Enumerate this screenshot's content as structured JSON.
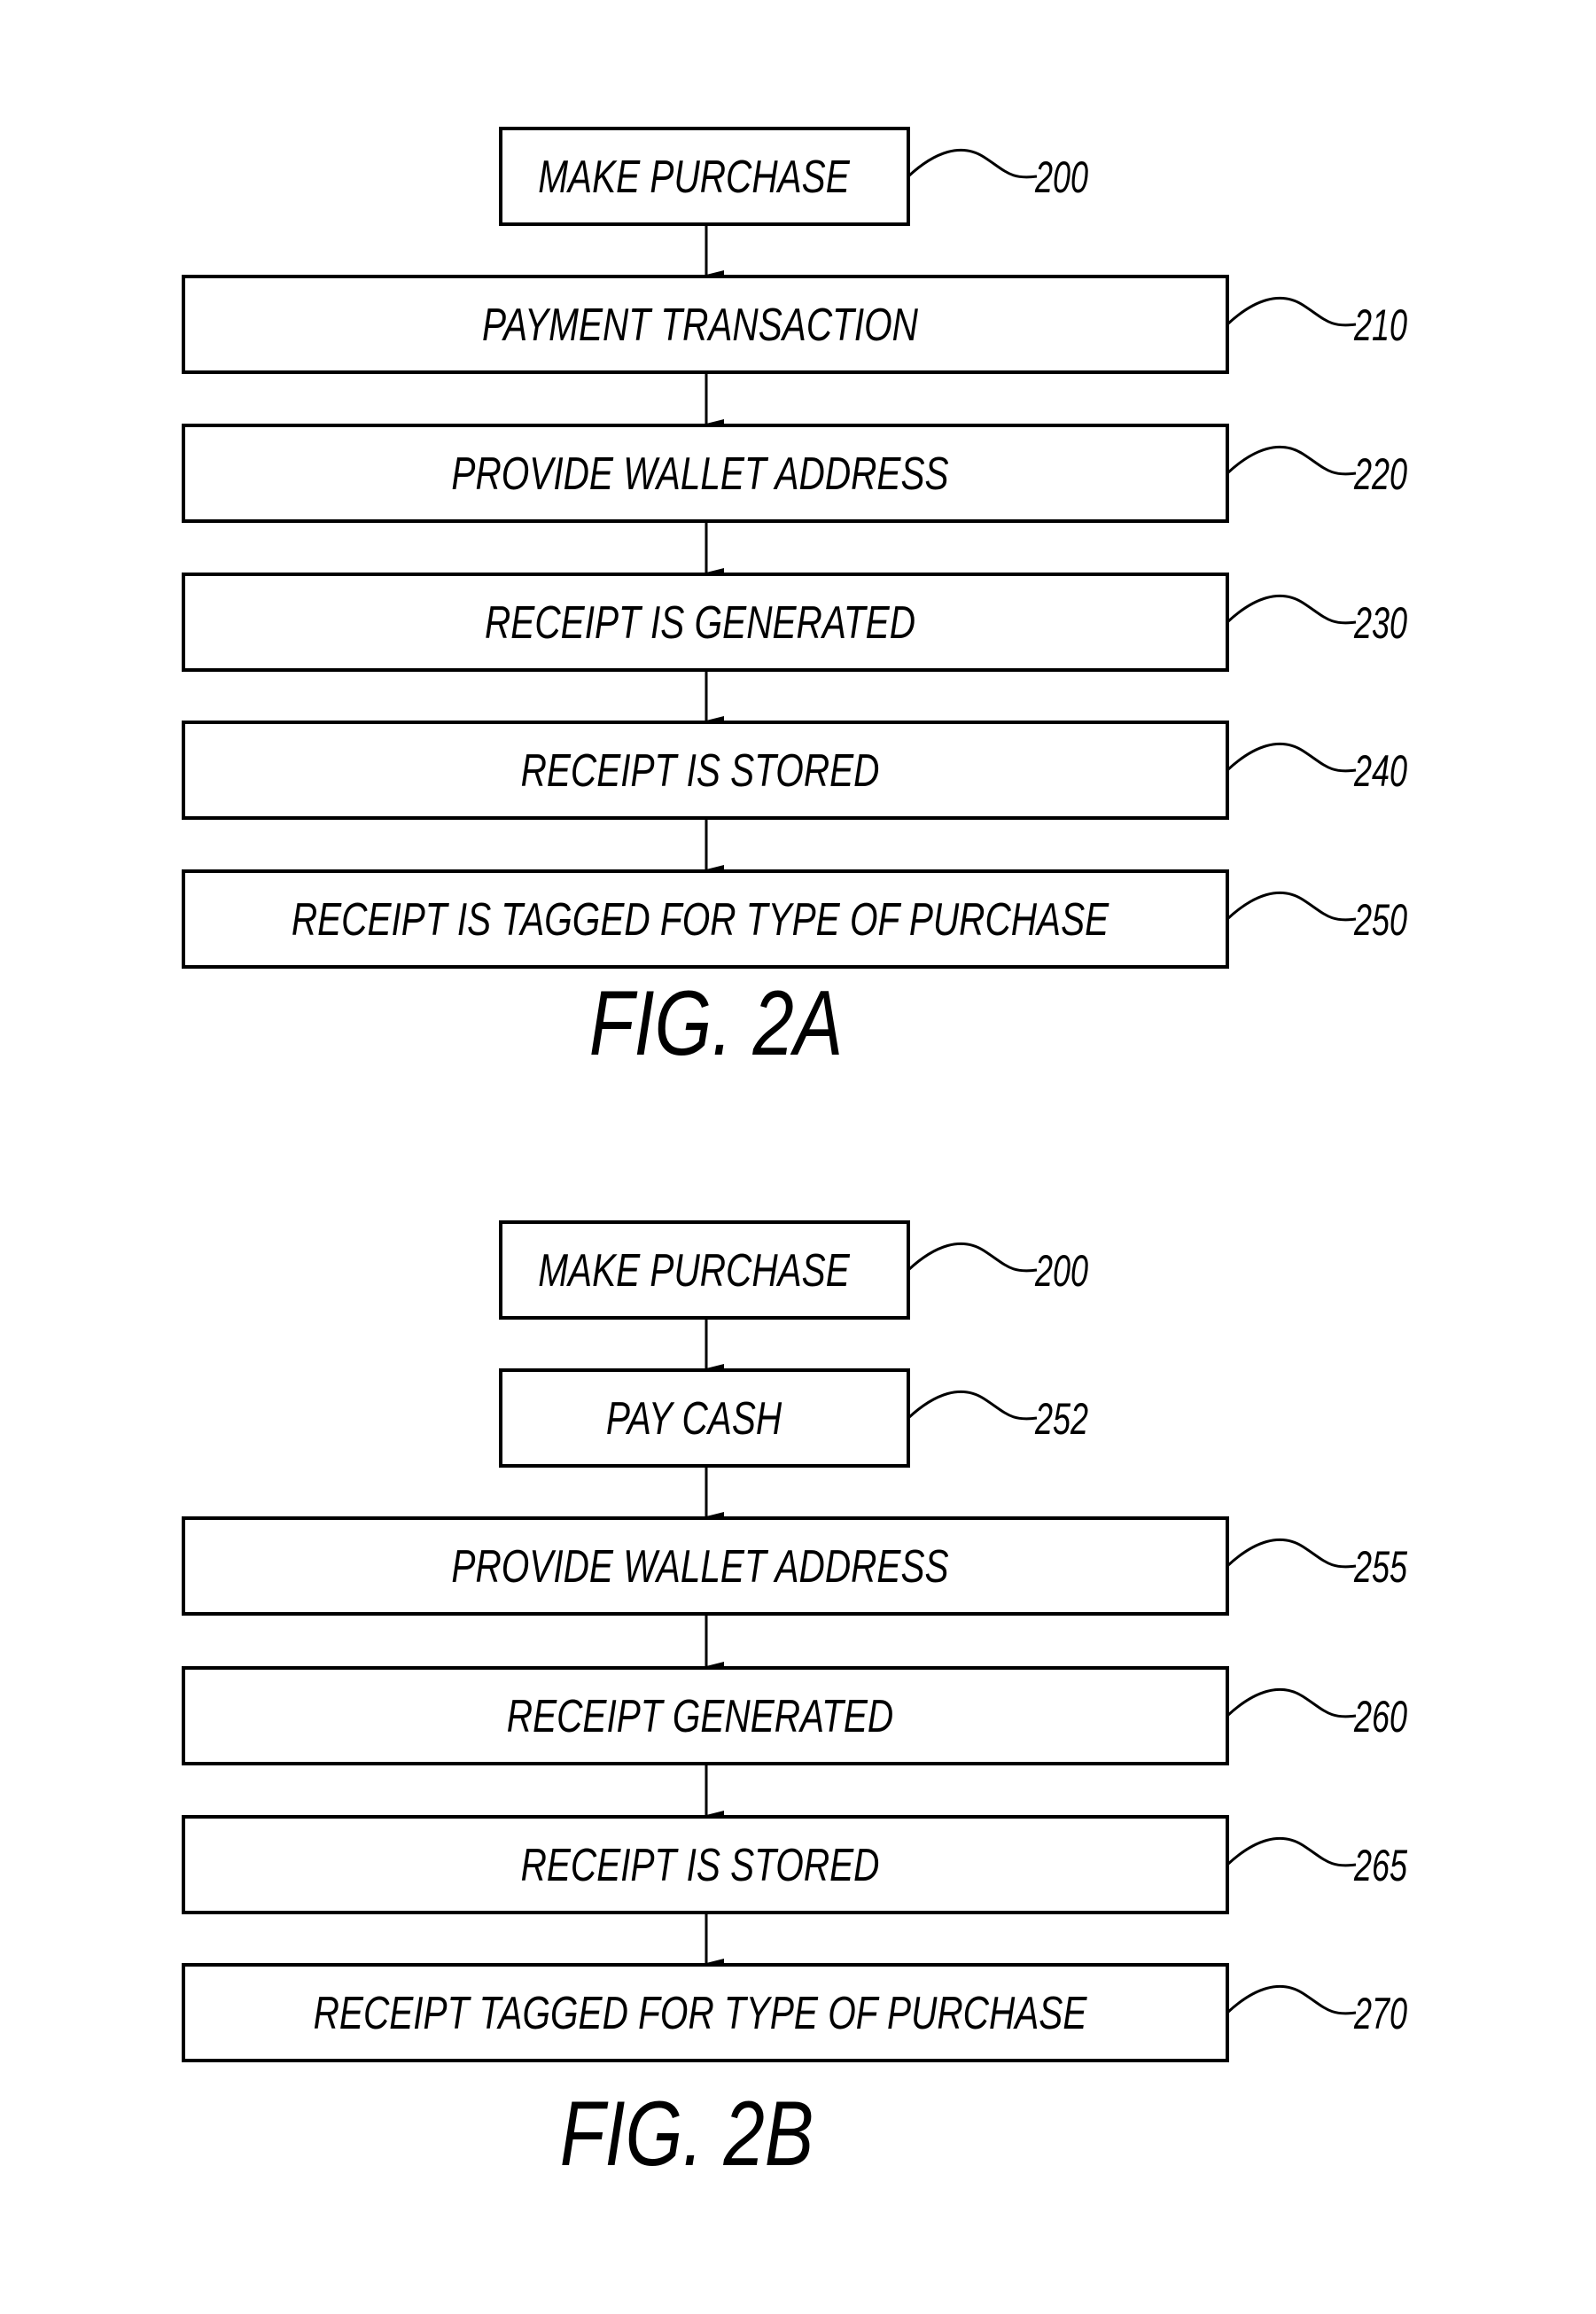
{
  "figures": [
    {
      "id": "fig-2a",
      "caption": "FIG. 2A",
      "steps": [
        {
          "text": "MAKE PURCHASE",
          "ref": "200",
          "size": "small"
        },
        {
          "text": "PAYMENT TRANSACTION",
          "ref": "210",
          "size": "wide"
        },
        {
          "text": "PROVIDE WALLET ADDRESS",
          "ref": "220",
          "size": "wide"
        },
        {
          "text": "RECEIPT IS GENERATED",
          "ref": "230",
          "size": "wide"
        },
        {
          "text": "RECEIPT IS STORED",
          "ref": "240",
          "size": "wide"
        },
        {
          "text": "RECEIPT IS TAGGED FOR TYPE OF PURCHASE",
          "ref": "250",
          "size": "wide"
        }
      ]
    },
    {
      "id": "fig-2b",
      "caption": "FIG. 2B",
      "steps": [
        {
          "text": "MAKE PURCHASE",
          "ref": "200",
          "size": "small"
        },
        {
          "text": "PAY CASH",
          "ref": "252",
          "size": "small"
        },
        {
          "text": "PROVIDE WALLET ADDRESS",
          "ref": "255",
          "size": "wide"
        },
        {
          "text": "RECEIPT GENERATED",
          "ref": "260",
          "size": "wide"
        },
        {
          "text": "RECEIPT IS STORED",
          "ref": "265",
          "size": "wide"
        },
        {
          "text": "RECEIPT TAGGED FOR TYPE OF PURCHASE",
          "ref": "270",
          "size": "wide"
        }
      ]
    }
  ],
  "colors": {
    "line": "#000000",
    "background": "#ffffff"
  }
}
